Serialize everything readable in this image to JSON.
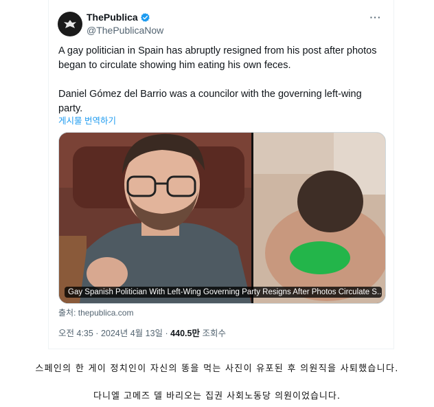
{
  "tweet": {
    "author": {
      "display_name": "ThePublica",
      "handle": "@ThePublicaNow",
      "verified": true
    },
    "more_icon": "more-dots-icon",
    "body": [
      "A gay politician in Spain has abruptly resigned from his post after photos began to circulate showing him eating his own feces.",
      "Daniel Gómez del Barrio was a councilor with the governing left-wing party."
    ],
    "translate_label": "게시물 번역하기",
    "media": {
      "caption": "Gay Spanish Politician With Left-Wing Governing Party Resigns After Photos Circulate S..."
    },
    "source": "출처: thepublica.com",
    "meta": {
      "time": "오전 4:35",
      "date": "2024년 4월 13일",
      "views": "440.5만",
      "views_label": "조회수"
    }
  },
  "korean_caption": {
    "line1": "스페인의 한 게이 정치인이 자신의 똥을 먹는 사진이 유포된 후 의원직을 사퇴했습니다.",
    "line2": "다니엘 고메즈 델 바리오는 집권 사회노동당 의원이었습니다."
  },
  "colors": {
    "accent": "#1d9bf0",
    "muted": "#536471",
    "text": "#0f1419"
  }
}
